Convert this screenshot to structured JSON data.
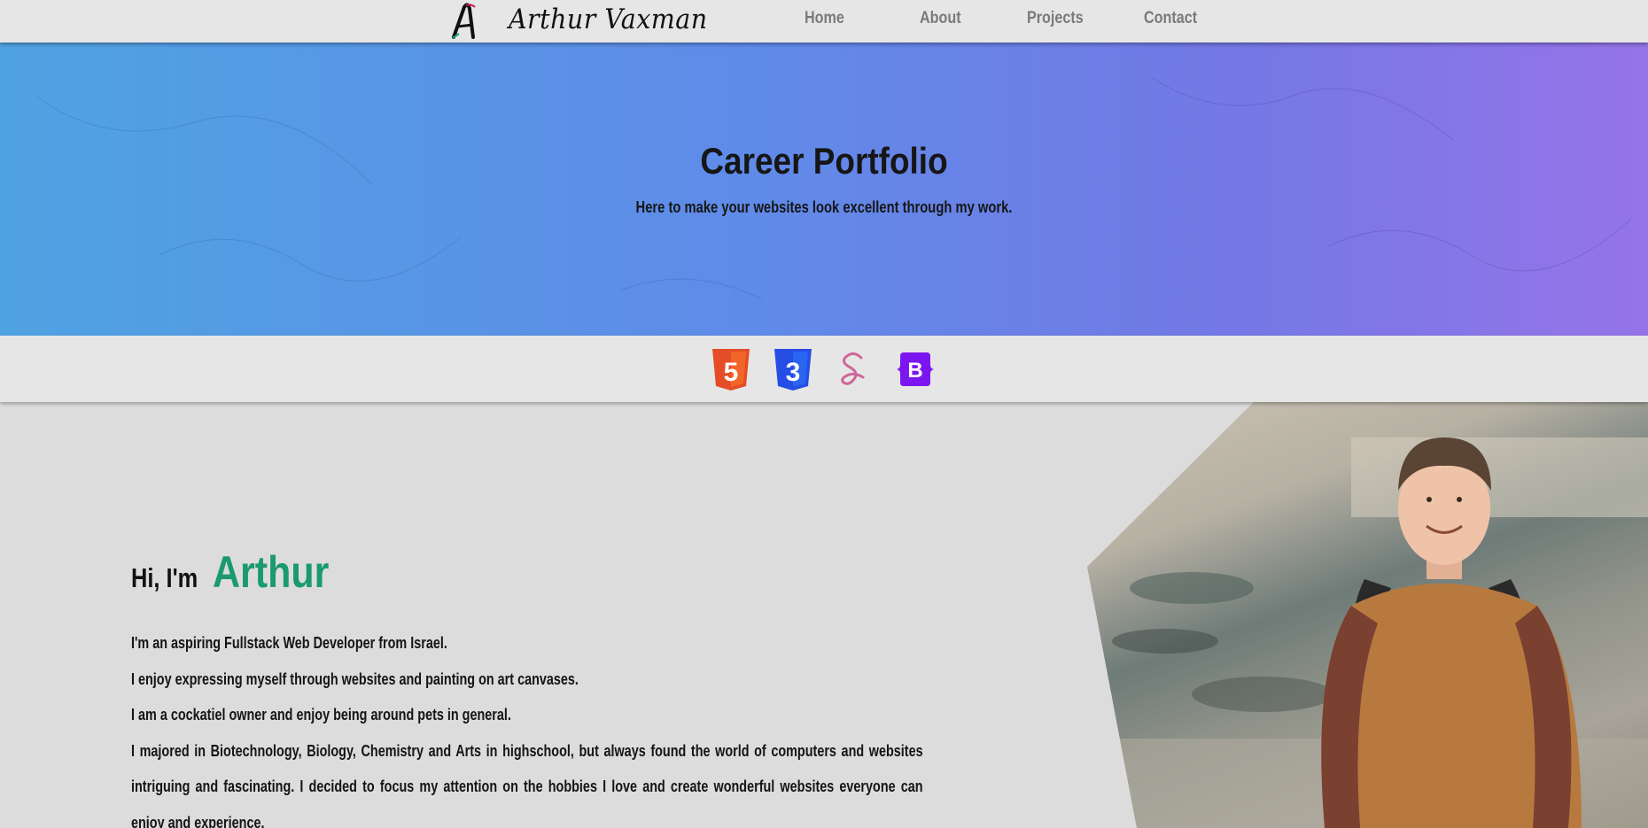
{
  "navbar": {
    "brand": "Arthur Vaxman",
    "links": [
      {
        "label": "Home"
      },
      {
        "label": "About"
      },
      {
        "label": "Projects"
      },
      {
        "label": "Contact"
      }
    ]
  },
  "hero": {
    "title": "Career Portfolio",
    "subtitle": "Here to make your websites look excellent through my work."
  },
  "tech_icons": [
    {
      "icon": "html5-icon",
      "label": "5",
      "color": "#e44d26"
    },
    {
      "icon": "css3-icon",
      "label": "3",
      "color": "#264de4"
    },
    {
      "icon": "sass-icon",
      "label": "S",
      "color": "#cd6799"
    },
    {
      "icon": "bootstrap-icon",
      "label": "B",
      "color": "#7c16f0"
    }
  ],
  "about": {
    "greeting": "Hi, I'm",
    "name": "Arthur",
    "paragraphs": [
      "I'm an aspiring Fullstack Web Developer from Israel.",
      "I enjoy expressing myself through websites and painting on art canvases.",
      "I am a cockatiel owner and enjoy being around pets in general.",
      "I majored in Biotechnology, Biology, Chemistry and Arts in highschool, but always found the world of computers and websites intriguing and fascinating. I decided to focus my attention on the hobbies I love and create wonderful websites everyone can enjoy and experience."
    ]
  },
  "colors": {
    "accent_name": "#1a9a6e",
    "hero_gradient_start": "#4fa3e3",
    "hero_gradient_end": "#9574e8"
  }
}
